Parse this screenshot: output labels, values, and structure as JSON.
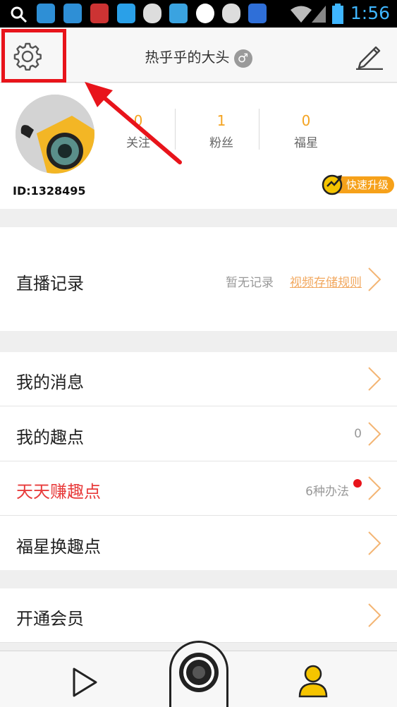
{
  "status_bar": {
    "time": "1:56",
    "icons": [
      "search-icon",
      "app-icon",
      "app-icon",
      "sogou-input-icon",
      "qq-icon",
      "cloud-icon",
      "frog-icon",
      "browser-icon",
      "cloud-icon",
      "baidu-icon",
      "wifi-icon",
      "signal-icon",
      "battery-icon"
    ],
    "time_color": "#3fb6ff"
  },
  "header": {
    "title": "热乎乎的大头",
    "gender_symbol": "♂"
  },
  "profile": {
    "user_id": "ID:1328495",
    "stats": [
      {
        "value": "0",
        "label": "关注"
      },
      {
        "value": "1",
        "label": "粉丝"
      },
      {
        "value": "0",
        "label": "福星"
      }
    ],
    "upgrade_label": "快速升级"
  },
  "live_record": {
    "label": "直播记录",
    "status": "暂无记录",
    "rules_link": "视频存储规则"
  },
  "menu": [
    {
      "label": "我的消息",
      "value": ""
    },
    {
      "label": "我的趣点",
      "value": "0"
    },
    {
      "label": "天天赚趣点",
      "value": "6种办法"
    },
    {
      "label": "福星换趣点",
      "value": ""
    }
  ],
  "member": {
    "label": "开通会员"
  },
  "colors": {
    "accent": "#f4a422",
    "highlight": "#e8141b",
    "earn_label": "#e83b3b",
    "link": "#f2a85f"
  },
  "bottom_nav": [
    "play-icon",
    "camera-icon",
    "user-icon"
  ]
}
